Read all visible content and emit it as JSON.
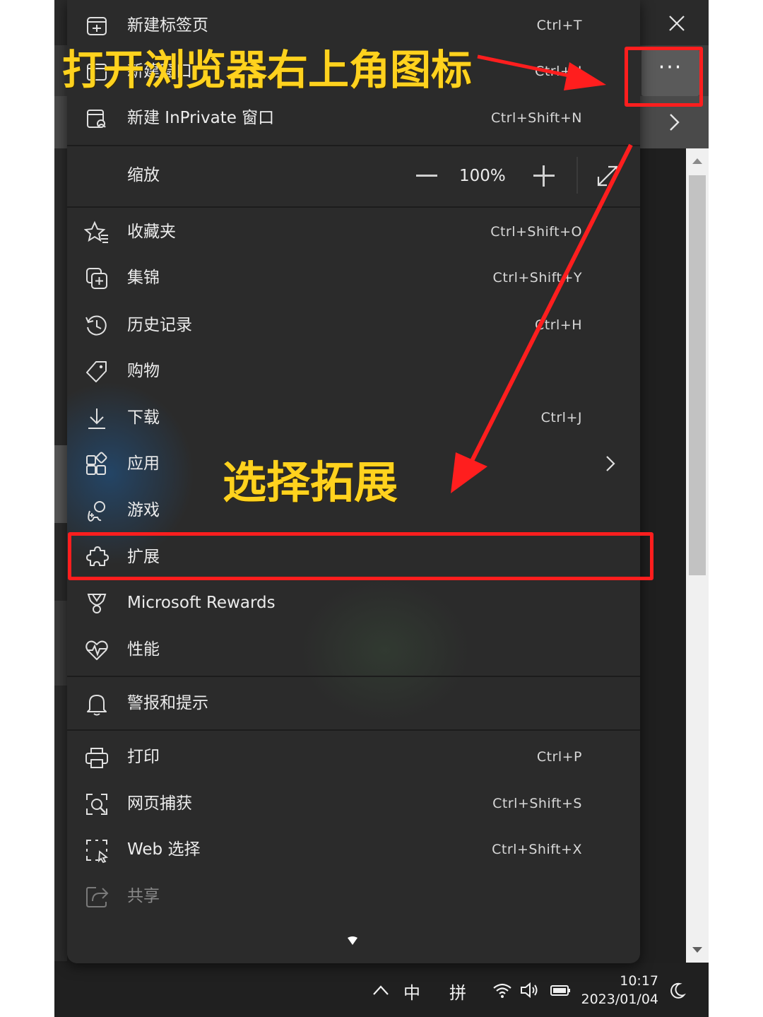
{
  "menu": {
    "items": [
      {
        "label": "新建标签页",
        "shortcut": "Ctrl+T",
        "icon": "new-tab-icon"
      },
      {
        "label": "新建窗口",
        "shortcut": "Ctrl+N",
        "icon": "new-window-icon"
      },
      {
        "label": "新建 InPrivate 窗口",
        "shortcut": "Ctrl+Shift+N",
        "icon": "inprivate-window-icon"
      },
      {
        "label": "收藏夹",
        "shortcut": "Ctrl+Shift+O",
        "icon": "favorites-star-icon"
      },
      {
        "label": "集锦",
        "shortcut": "Ctrl+Shift+Y",
        "icon": "collections-icon"
      },
      {
        "label": "历史记录",
        "shortcut": "Ctrl+H",
        "icon": "history-icon"
      },
      {
        "label": "购物",
        "shortcut": "",
        "icon": "shopping-tag-icon"
      },
      {
        "label": "下载",
        "shortcut": "Ctrl+J",
        "icon": "download-icon"
      },
      {
        "label": "应用",
        "shortcut": "",
        "icon": "apps-icon"
      },
      {
        "label": "游戏",
        "shortcut": "",
        "icon": "games-icon"
      },
      {
        "label": "扩展",
        "shortcut": "",
        "icon": "extensions-puzzle-icon"
      },
      {
        "label": "Microsoft Rewards",
        "shortcut": "",
        "icon": "rewards-trophy-icon"
      },
      {
        "label": "性能",
        "shortcut": "",
        "icon": "performance-heart-icon"
      },
      {
        "label": "警报和提示",
        "shortcut": "",
        "icon": "alerts-bell-icon"
      },
      {
        "label": "打印",
        "shortcut": "Ctrl+P",
        "icon": "print-icon"
      },
      {
        "label": "网页捕获",
        "shortcut": "Ctrl+Shift+S",
        "icon": "web-capture-icon"
      },
      {
        "label": "Web 选择",
        "shortcut": "Ctrl+Shift+X",
        "icon": "web-select-icon"
      },
      {
        "label": "共享",
        "shortcut": "",
        "icon": "share-icon"
      }
    ],
    "zoom": {
      "label": "缩放",
      "value": "100%"
    }
  },
  "annotations": {
    "top_text": "打开浏览器右上角图标",
    "mid_text": "选择拓展",
    "color_text": "#ffd21e",
    "color_box": "#ff1e1e"
  },
  "browser": {
    "more_label": "···"
  },
  "taskbar": {
    "ime_lang": "中",
    "ime_mode": "拼",
    "time": "10:17",
    "date": "2023/01/04"
  }
}
